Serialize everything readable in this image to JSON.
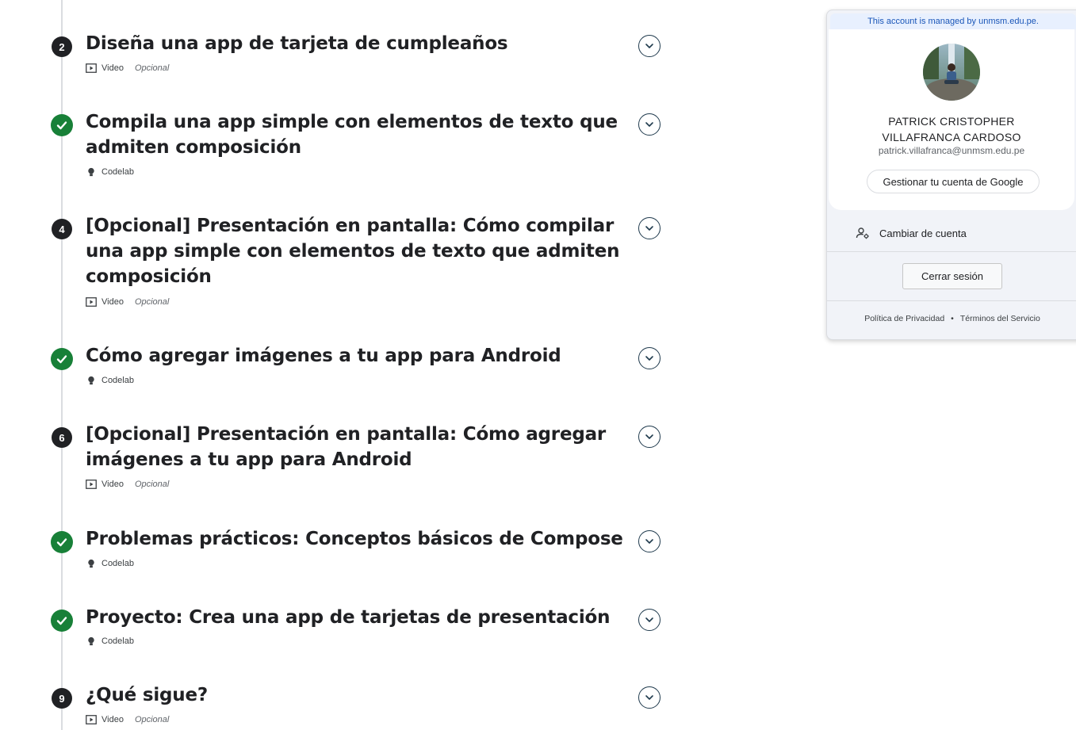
{
  "steps": [
    {
      "marker": "2",
      "status": "numbered",
      "title": "Diseña una app de tarjeta de cumpleaños",
      "type": "Video",
      "type_icon": "video-icon",
      "optional": "Opcional"
    },
    {
      "marker": "",
      "status": "completed",
      "title": "Compila una app simple con elementos de texto que admiten composición",
      "type": "Codelab",
      "type_icon": "codelab-bulb-icon",
      "optional": ""
    },
    {
      "marker": "4",
      "status": "numbered",
      "title": "[Opcional] Presentación en pantalla: Cómo compilar una app simple con elementos de texto que admiten composición",
      "type": "Video",
      "type_icon": "video-icon",
      "optional": "Opcional"
    },
    {
      "marker": "",
      "status": "completed",
      "title": "Cómo agregar imágenes a tu app para Android",
      "type": "Codelab",
      "type_icon": "codelab-bulb-icon",
      "optional": ""
    },
    {
      "marker": "6",
      "status": "numbered",
      "title": "[Opcional] Presentación en pantalla: Cómo agregar imágenes a tu app para Android",
      "type": "Video",
      "type_icon": "video-icon",
      "optional": "Opcional"
    },
    {
      "marker": "",
      "status": "completed",
      "title": "Problemas prácticos: Conceptos básicos de Compose",
      "type": "Codelab",
      "type_icon": "codelab-bulb-icon",
      "optional": ""
    },
    {
      "marker": "",
      "status": "completed",
      "title": "Proyecto: Crea una app de tarjetas de presentación",
      "type": "Codelab",
      "type_icon": "codelab-bulb-icon",
      "optional": ""
    },
    {
      "marker": "9",
      "status": "numbered",
      "title": "¿Qué sigue?",
      "type": "Video",
      "type_icon": "video-icon",
      "optional": "Opcional"
    }
  ],
  "account": {
    "managed_banner": "This account is managed by unmsm.edu.pe.",
    "name_line1": "PATRICK CRISTOPHER",
    "name_line2": "VILLAFRANCA CARDOSO",
    "email": "patrick.villafranca@unmsm.edu.pe",
    "manage_label": "Gestionar tu cuenta de Google",
    "switch_label": "Cambiar de cuenta",
    "signout_label": "Cerrar sesión",
    "privacy_label": "Política de Privacidad",
    "separator": "•",
    "terms_label": "Términos del Servicio"
  },
  "colors": {
    "completed": "#188038",
    "numbered": "#202124",
    "banner_text": "#1a56b8"
  }
}
